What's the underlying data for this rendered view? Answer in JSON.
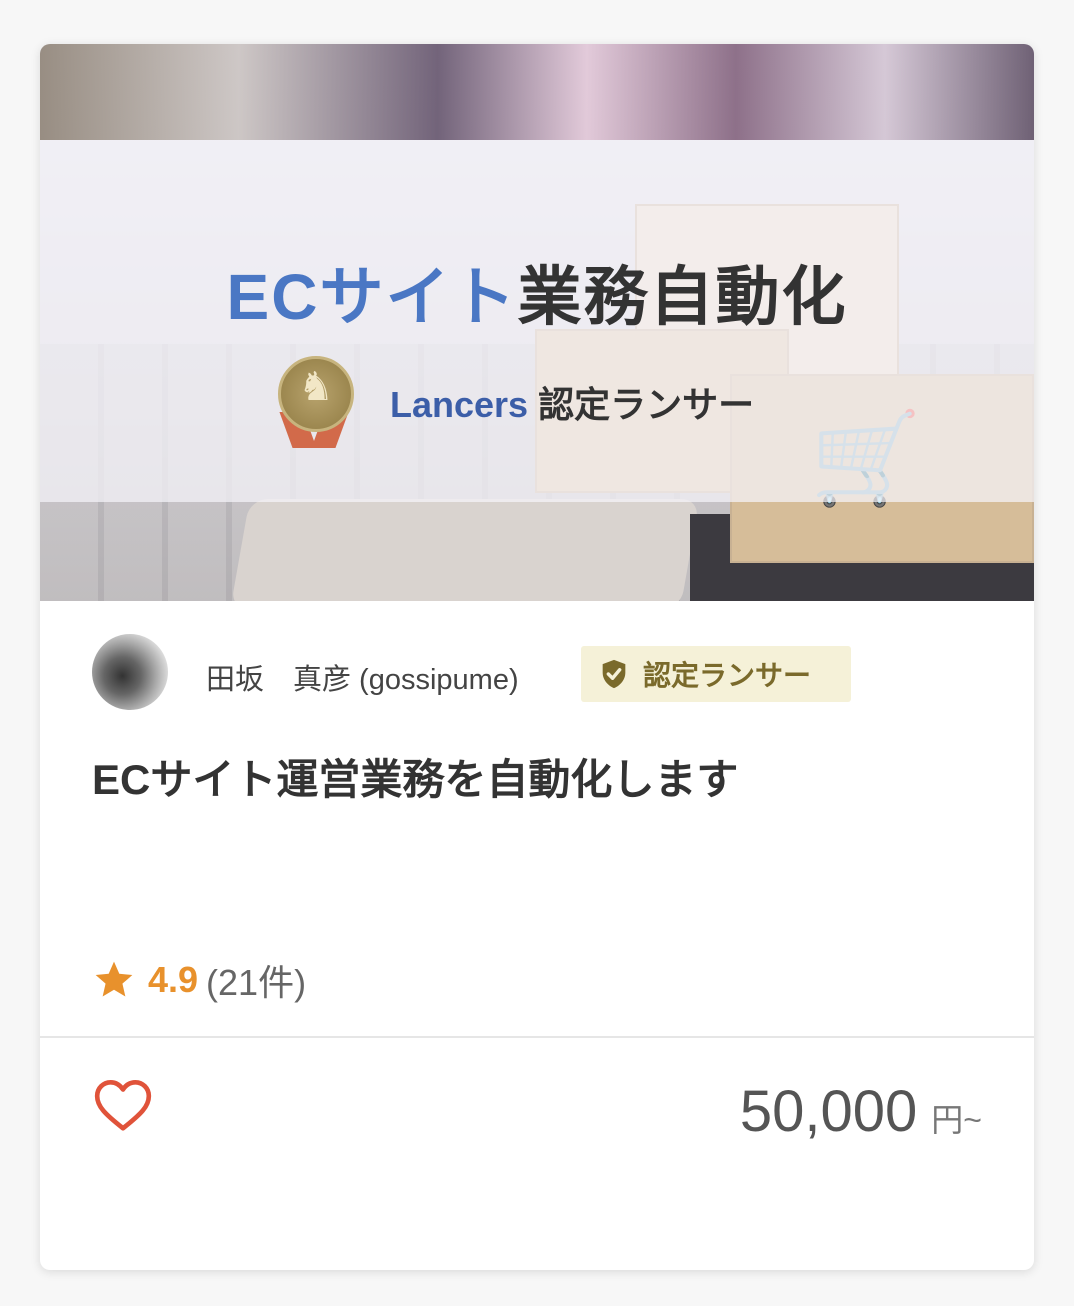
{
  "thumbnail": {
    "title_accent": "ECサイト",
    "title_rest": "業務自動化",
    "sub_brand": "Lancers",
    "sub_label": "認定ランサー"
  },
  "seller": {
    "name": "田坂　真彦 (gossipume)",
    "badge_label": "認定ランサー"
  },
  "service": {
    "title": "ECサイト運営業務を自動化します"
  },
  "rating": {
    "score": "4.9",
    "count": "(21件)"
  },
  "price": {
    "amount": "50,000",
    "unit": "円~"
  },
  "colors": {
    "accent_blue": "#4a77c4",
    "rating_orange": "#e8912c",
    "heart_red": "#e0533a",
    "badge_bg": "#f5f1d8",
    "badge_text": "#7a6a2b"
  },
  "icons": {
    "badge": "shield-check-icon",
    "rating": "star-icon",
    "favorite": "heart-icon",
    "medal": "medal-icon",
    "cart": "cart-icon"
  }
}
